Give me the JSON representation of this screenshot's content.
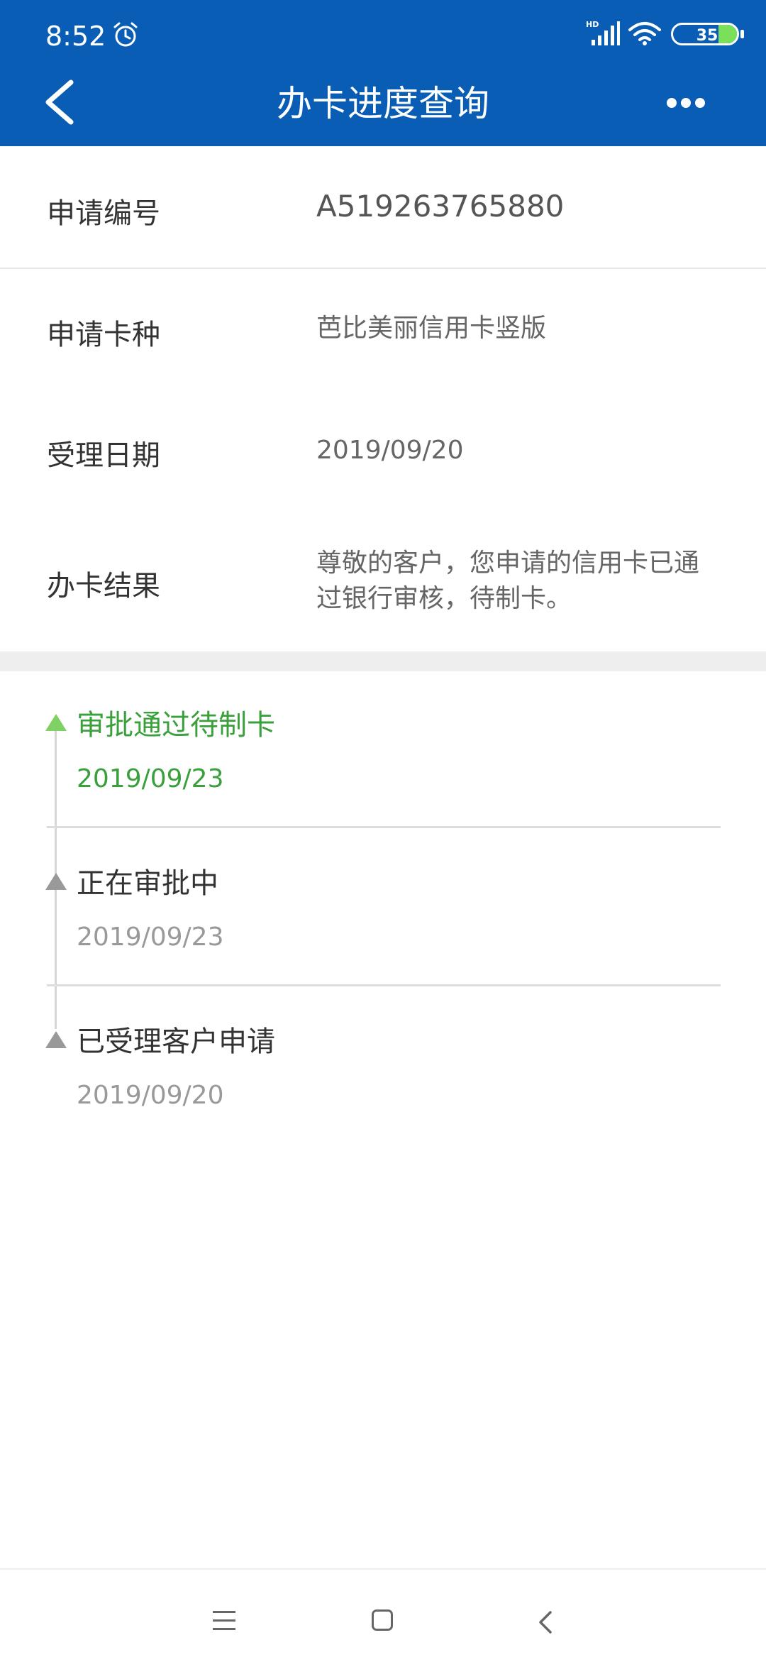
{
  "status_bar": {
    "time": "8:52",
    "battery_level": "35",
    "icons": [
      "alarm-icon",
      "hd-signal-icon",
      "wifi-icon",
      "battery-icon"
    ]
  },
  "header": {
    "title": "办卡进度查询",
    "back_icon": "chevron-left-icon",
    "more_icon": "more-horizontal-icon",
    "background_color": "#0a5db5"
  },
  "application": {
    "rows": [
      {
        "label": "申请编号",
        "value": "A519263765880"
      },
      {
        "label": "申请卡种",
        "value": "芭比美丽信用卡竖版"
      },
      {
        "label": "受理日期",
        "value": "2019/09/20"
      },
      {
        "label": "办卡结果",
        "value": "尊敬的客户，您申请的信用卡已通过银行审核，待制卡。"
      }
    ]
  },
  "timeline": {
    "active_color": "#39a03c",
    "steps": [
      {
        "title": "审批通过待制卡",
        "date": "2019/09/23",
        "active": true
      },
      {
        "title": "正在审批中",
        "date": "2019/09/23",
        "active": false
      },
      {
        "title": "已受理客户申请",
        "date": "2019/09/20",
        "active": false
      }
    ]
  },
  "nav_bar": {
    "icons": [
      "menu-icon",
      "home-icon",
      "back-icon"
    ]
  }
}
